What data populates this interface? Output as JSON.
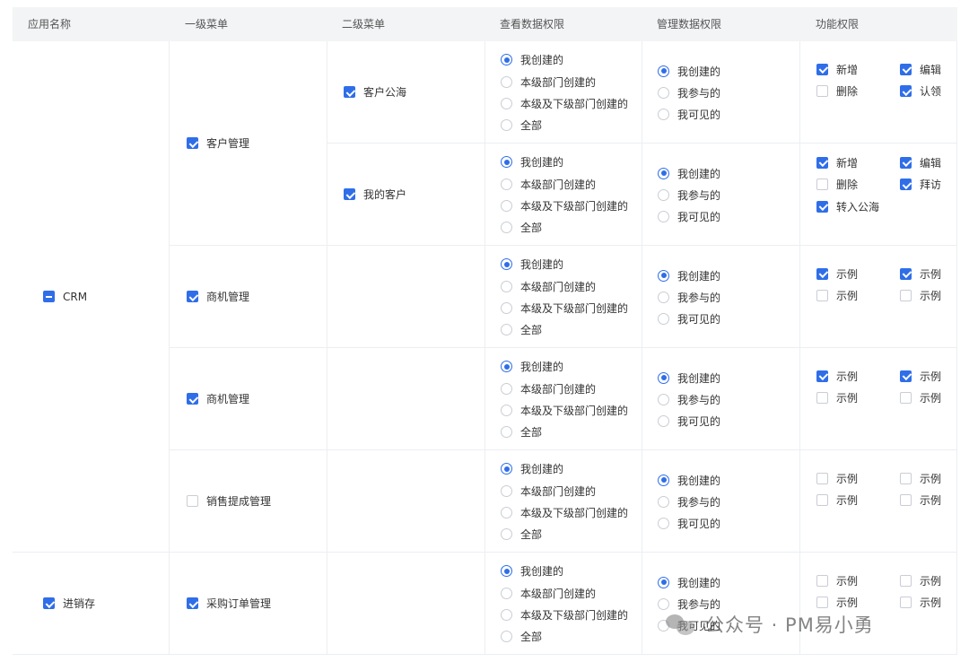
{
  "headers": [
    "应用名称",
    "一级菜单",
    "二级菜单",
    "查看数据权限",
    "管理数据权限",
    "功能权限"
  ],
  "view_options": [
    "我创建的",
    "本级部门创建的",
    "本级及下级部门创建的",
    "全部"
  ],
  "manage_options": [
    "我创建的",
    "我参与的",
    "我可见的"
  ],
  "apps": [
    {
      "label": "CRM",
      "state": "indeterminate"
    },
    {
      "label": "进销存",
      "state": "checked"
    }
  ],
  "menus": [
    {
      "label": "客户管理",
      "checked": true
    },
    {
      "label": "商机管理",
      "checked": true
    },
    {
      "label": "商机管理",
      "checked": true
    },
    {
      "label": "销售提成管理",
      "checked": false
    },
    {
      "label": "采购订单管理",
      "checked": true
    }
  ],
  "submenus": [
    {
      "label": "客户公海",
      "checked": true
    },
    {
      "label": "我的客户",
      "checked": true
    }
  ],
  "rows": [
    {
      "view_selected": 0,
      "manage_selected": 0,
      "functions": [
        {
          "label": "新增",
          "checked": true
        },
        {
          "label": "编辑",
          "checked": true
        },
        {
          "label": "删除",
          "checked": false
        },
        {
          "label": "认领",
          "checked": true
        }
      ]
    },
    {
      "view_selected": 0,
      "manage_selected": 0,
      "functions": [
        {
          "label": "新增",
          "checked": true
        },
        {
          "label": "编辑",
          "checked": true
        },
        {
          "label": "删除",
          "checked": false
        },
        {
          "label": "拜访",
          "checked": true
        },
        {
          "label": "转入公海",
          "checked": true
        }
      ]
    },
    {
      "view_selected": 0,
      "manage_selected": 0,
      "functions": [
        {
          "label": "示例",
          "checked": true
        },
        {
          "label": "示例",
          "checked": true
        },
        {
          "label": "示例",
          "checked": false
        },
        {
          "label": "示例",
          "checked": false
        }
      ]
    },
    {
      "view_selected": 0,
      "manage_selected": 0,
      "functions": [
        {
          "label": "示例",
          "checked": true
        },
        {
          "label": "示例",
          "checked": true
        },
        {
          "label": "示例",
          "checked": false
        },
        {
          "label": "示例",
          "checked": false
        }
      ]
    },
    {
      "view_selected": 0,
      "manage_selected": 0,
      "functions": [
        {
          "label": "示例",
          "checked": false
        },
        {
          "label": "示例",
          "checked": false
        },
        {
          "label": "示例",
          "checked": false
        },
        {
          "label": "示例",
          "checked": false
        }
      ]
    },
    {
      "view_selected": 0,
      "manage_selected": 0,
      "functions": [
        {
          "label": "示例",
          "checked": false
        },
        {
          "label": "示例",
          "checked": false
        },
        {
          "label": "示例",
          "checked": false
        },
        {
          "label": "示例",
          "checked": false
        }
      ]
    }
  ],
  "watermark": "公众号 · PM易小勇",
  "colors": {
    "accent": "#2f6ee8",
    "header_bg": "#f3f4f6",
    "border": "#eceef2"
  }
}
